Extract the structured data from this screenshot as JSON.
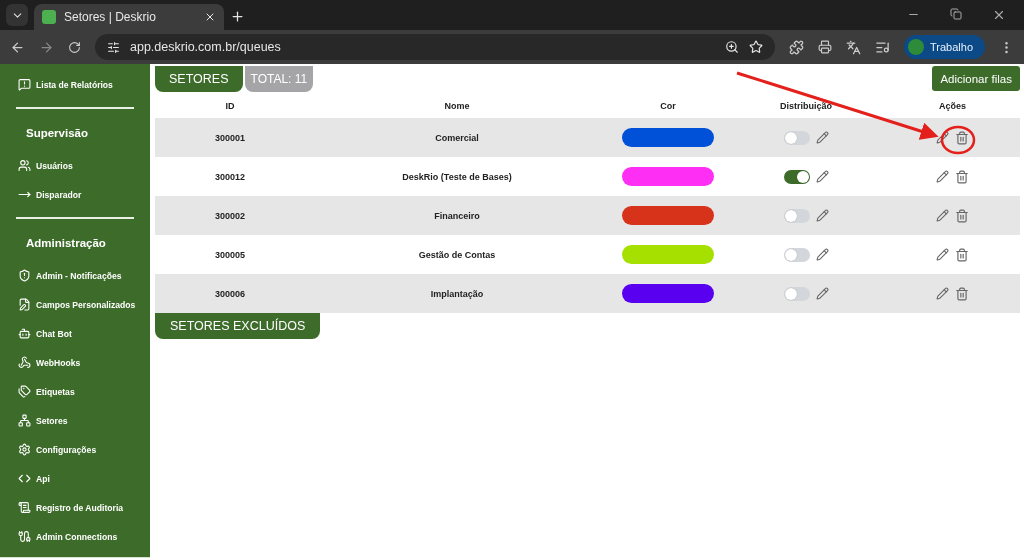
{
  "browser": {
    "tabs": [
      {
        "title": "Setores | Deskrio",
        "selected": true
      }
    ],
    "url": "app.deskrio.com.br/queues",
    "profile": "Trabalho"
  },
  "sidebar": {
    "sections": [
      {
        "items": [
          {
            "label": "Lista de Relatórios",
            "kind": "report"
          }
        ]
      },
      {
        "heading": "Supervisão",
        "items": [
          {
            "label": "Usuários",
            "kind": "users"
          },
          {
            "label": "Disparador",
            "kind": "arrow"
          }
        ]
      },
      {
        "heading": "Administração",
        "items": [
          {
            "label": "Admin - Notificações",
            "kind": "shield"
          },
          {
            "label": "Campos Personalizados",
            "kind": "form"
          },
          {
            "label": "Chat Bot",
            "kind": "bot"
          },
          {
            "label": "WebHooks",
            "kind": "webhook"
          },
          {
            "label": "Etiquetas",
            "kind": "tags"
          },
          {
            "label": "Setores",
            "kind": "network"
          },
          {
            "label": "Configurações",
            "kind": "gear"
          },
          {
            "label": "Api",
            "kind": "code"
          },
          {
            "label": "Registro de Auditoria",
            "kind": "scroll"
          },
          {
            "label": "Admin Connections",
            "kind": "plug"
          }
        ]
      }
    ]
  },
  "header": {
    "title": "SETORES",
    "total": "TOTAL: 11",
    "add_button": "Adicionar filas"
  },
  "table": {
    "columns": [
      "ID",
      "Nome",
      "Cor",
      "Distribuição",
      "Ações"
    ],
    "rows": [
      {
        "id": "300001",
        "name": "Comercial",
        "color": "#0050d8",
        "distribution": false,
        "highlighted": true
      },
      {
        "id": "300012",
        "name": "DeskRio (Teste de Bases)",
        "color": "#ff2ef4",
        "distribution": true,
        "highlighted": false
      },
      {
        "id": "300002",
        "name": "Financeiro",
        "color": "#d7321a",
        "distribution": false,
        "highlighted": false
      },
      {
        "id": "300005",
        "name": "Gestão de Contas",
        "color": "#a6e000",
        "distribution": false,
        "highlighted": false
      },
      {
        "id": "300006",
        "name": "Implantação",
        "color": "#5a00f0",
        "distribution": false,
        "highlighted": false
      }
    ]
  },
  "deleted_button": "SETORES EXCLUÍDOS"
}
